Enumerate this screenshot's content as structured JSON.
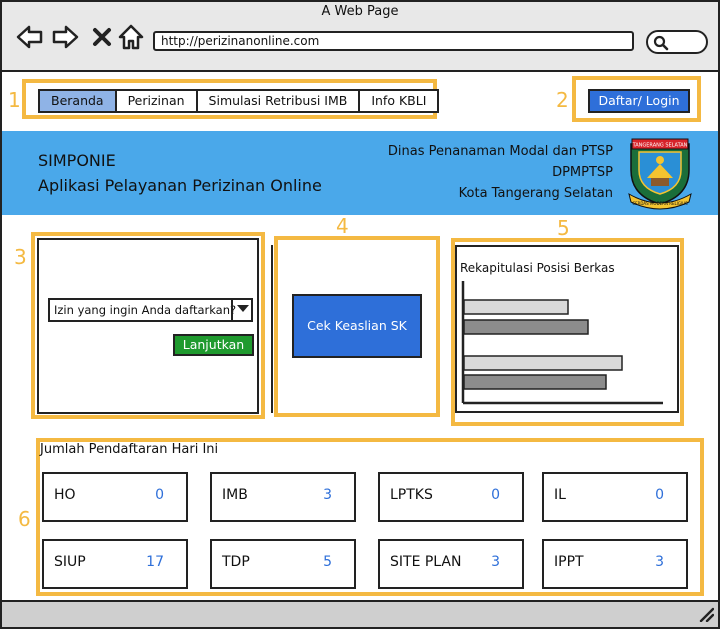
{
  "browser": {
    "window_title": "A Web Page",
    "url": "http://perizinanonline.com"
  },
  "zones": [
    "1",
    "2",
    "3",
    "4",
    "5",
    "6"
  ],
  "nav": {
    "items": [
      {
        "label": "Beranda",
        "active": true
      },
      {
        "label": "Perizinan",
        "active": false
      },
      {
        "label": "Simulasi Retribusi IMB",
        "active": false
      },
      {
        "label": "Info KBLI",
        "active": false
      }
    ],
    "login_label": "Daftar/ Login"
  },
  "banner": {
    "title": "SIMPONIE",
    "subtitle": "Aplikasi Pelayanan Perizinan Online",
    "institution_lines": [
      "Dinas Penanaman Modal dan PTSP",
      "DPMPTSP",
      "Kota Tangerang Selatan"
    ],
    "logo_top_text": "TANGERANG SELATAN",
    "logo_ribbon_text": "CERDAS MODERN RELIGIUS"
  },
  "registration": {
    "select_value": "Izin yang ingin Anda daftarkan?",
    "continue_label": "Lanjutkan"
  },
  "verify": {
    "button_label": "Cek Keaslian SK"
  },
  "recap": {
    "title": "Rekapitulasi Posisi Berkas"
  },
  "chart_data": {
    "type": "bar",
    "orientation": "horizontal",
    "title": "Rekapitulasi Posisi Berkas",
    "categories": [
      "",
      "",
      "",
      ""
    ],
    "values": [
      0.52,
      0.62,
      0.79,
      0.71
    ],
    "colors": [
      "#d9d9d9",
      "#8c8c8c",
      "#d9d9d9",
      "#8c8c8c"
    ],
    "xlim": [
      0,
      1
    ],
    "grid": false
  },
  "stats": {
    "title": "Jumlah Pendaftaran Hari Ini",
    "items": [
      {
        "label": "HO",
        "value": "0"
      },
      {
        "label": "IMB",
        "value": "3"
      },
      {
        "label": "LPTKS",
        "value": "0"
      },
      {
        "label": "IL",
        "value": "0"
      },
      {
        "label": "SIUP",
        "value": "17"
      },
      {
        "label": "TDP",
        "value": "5"
      },
      {
        "label": "SITE PLAN",
        "value": "3"
      },
      {
        "label": "IPPT",
        "value": "3"
      }
    ]
  }
}
